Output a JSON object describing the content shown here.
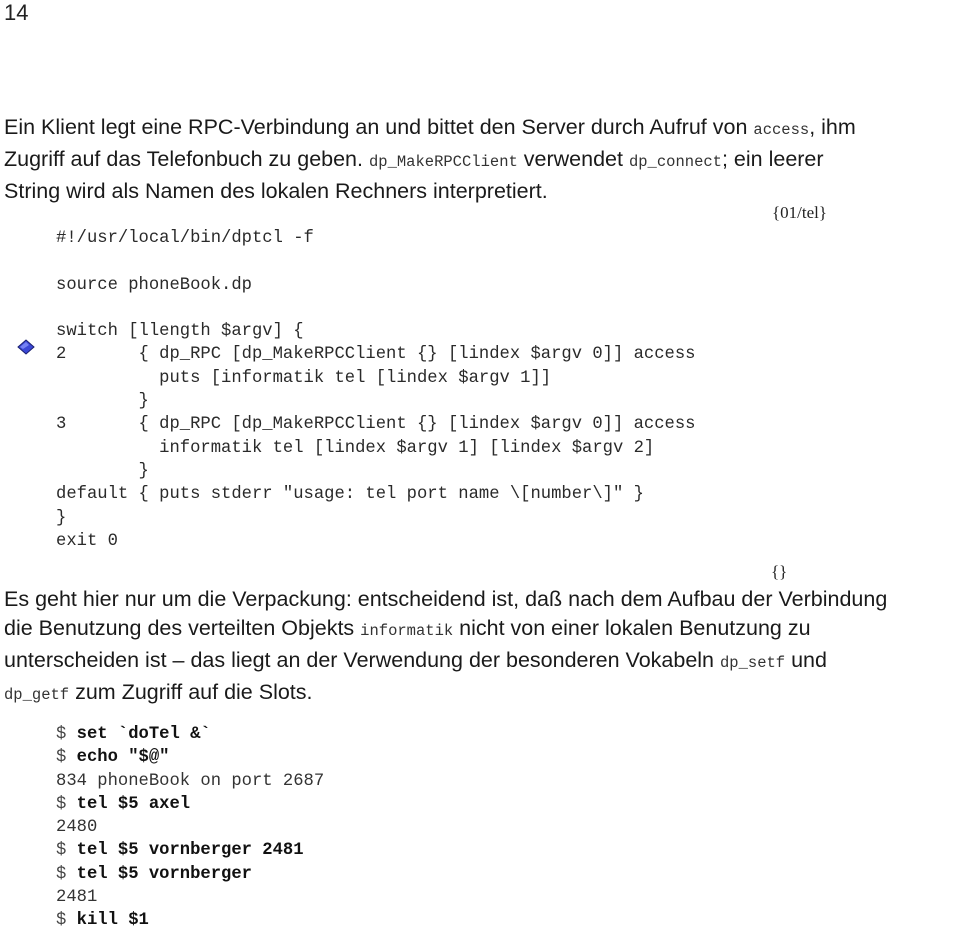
{
  "page": {
    "number": "14"
  },
  "intro": {
    "lines": [
      [
        {
          "t": "Ein Klient legt eine RPC-Verbindung an und bittet den Server durch Aufruf von ",
          "code": false
        },
        {
          "t": "access",
          "code": true
        },
        {
          "t": ", ihm",
          "code": false
        }
      ],
      [
        {
          "t": "Zugriff auf das Telefonbuch zu geben. ",
          "code": false
        },
        {
          "t": "dp_MakeRPCClient",
          "code": true
        },
        {
          "t": " verwendet ",
          "code": false
        },
        {
          "t": "dp_connect",
          "code": true
        },
        {
          "t": "; ein leerer",
          "code": false
        }
      ],
      [
        {
          "t": "String wird als Namen des lokalen Rechners interpretiert.",
          "code": false
        }
      ]
    ]
  },
  "listing": {
    "label": "{01/tel}",
    "marker_icon": "diamond-bullet",
    "marker_color": "#3b48d6",
    "lines": [
      "#!/usr/local/bin/dptcl -f",
      "",
      "source phoneBook.dp",
      "",
      "switch [llength $argv] {",
      "2       { dp_RPC [dp_MakeRPCClient {} [lindex $argv 0]] access",
      "          puts [informatik tel [lindex $argv 1]]",
      "        }",
      "3       { dp_RPC [dp_MakeRPCClient {} [lindex $argv 0]] access",
      "          informatik tel [lindex $argv 1] [lindex $argv 2]",
      "        }",
      "default { puts stderr \"usage: tel port name \\[number\\]\" }",
      "}",
      "exit 0"
    ],
    "end_label": "{}"
  },
  "explanation": {
    "lines": [
      [
        {
          "t": "Es geht hier nur um die Verpackung: entscheidend ist, daß nach dem Aufbau der Verbindung",
          "code": false
        }
      ],
      [
        {
          "t": "die Benutzung des verteilten Objekts ",
          "code": false
        },
        {
          "t": "informatik",
          "code": true
        },
        {
          "t": " nicht von einer lokalen Benutzung zu",
          "code": false
        }
      ],
      [
        {
          "t": "unterscheiden ist – das liegt an der Verwendung der besonderen Vokabeln ",
          "code": false
        },
        {
          "t": "dp_setf",
          "code": true
        },
        {
          "t": " und",
          "code": false
        }
      ],
      [
        {
          "t": "dp_getf",
          "code": true
        },
        {
          "t": " zum Zugriff auf die Slots.",
          "code": false
        }
      ]
    ]
  },
  "session": {
    "lines": [
      {
        "prompt": "$ ",
        "cmd": "set `doTel &`",
        "out": ""
      },
      {
        "prompt": "$ ",
        "cmd": "echo \"$@\"",
        "out": ""
      },
      {
        "prompt": "",
        "cmd": "",
        "out": "834 phoneBook on port 2687"
      },
      {
        "prompt": "$ ",
        "cmd": "tel $5 axel",
        "out": ""
      },
      {
        "prompt": "",
        "cmd": "",
        "out": "2480"
      },
      {
        "prompt": "$ ",
        "cmd": "tel $5 vornberger 2481",
        "out": ""
      },
      {
        "prompt": "$ ",
        "cmd": "tel $5 vornberger",
        "out": ""
      },
      {
        "prompt": "",
        "cmd": "",
        "out": "2481"
      },
      {
        "prompt": "$ ",
        "cmd": "kill $1",
        "out": ""
      }
    ]
  }
}
